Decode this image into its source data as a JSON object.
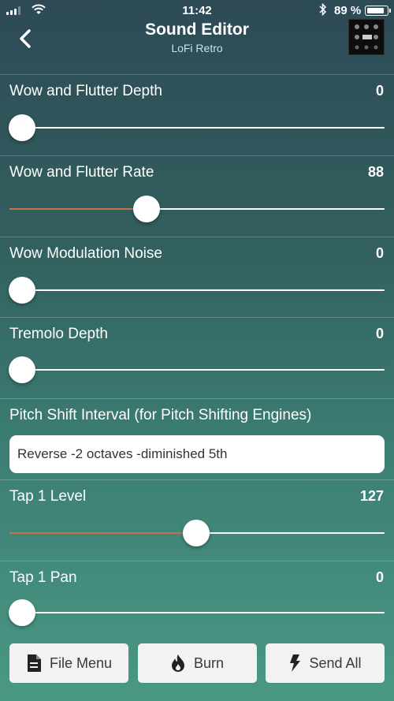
{
  "status_bar": {
    "time": "11:42",
    "battery_percent": "89 %",
    "battery_level": 0.89
  },
  "nav": {
    "title": "Sound Editor",
    "subtitle": "LoFi Retro"
  },
  "params": [
    {
      "label": "Wow and Flutter Depth",
      "value": "0",
      "fraction": 0.0
    },
    {
      "label": "Wow and Flutter Rate",
      "value": "88",
      "fraction": 0.355
    },
    {
      "label": "Wow Modulation Noise",
      "value": "0",
      "fraction": 0.0
    },
    {
      "label": "Tremolo Depth",
      "value": "0",
      "fraction": 0.0
    },
    {
      "label": "Tap 1 Level",
      "value": "127",
      "fraction": 0.497
    },
    {
      "label": "Tap 1 Pan",
      "value": "0",
      "fraction": 0.0
    }
  ],
  "pitch_shift": {
    "label": "Pitch Shift Interval (for Pitch Shifting Engines)",
    "selected": "Reverse -2 octaves -diminished 5th"
  },
  "buttons": {
    "file_menu": "File Menu",
    "burn": "Burn",
    "send_all": "Send All"
  },
  "colors": {
    "slider_fill": "#c8704a",
    "background_top": "#2d4a55",
    "background_bottom": "#4a9884"
  }
}
